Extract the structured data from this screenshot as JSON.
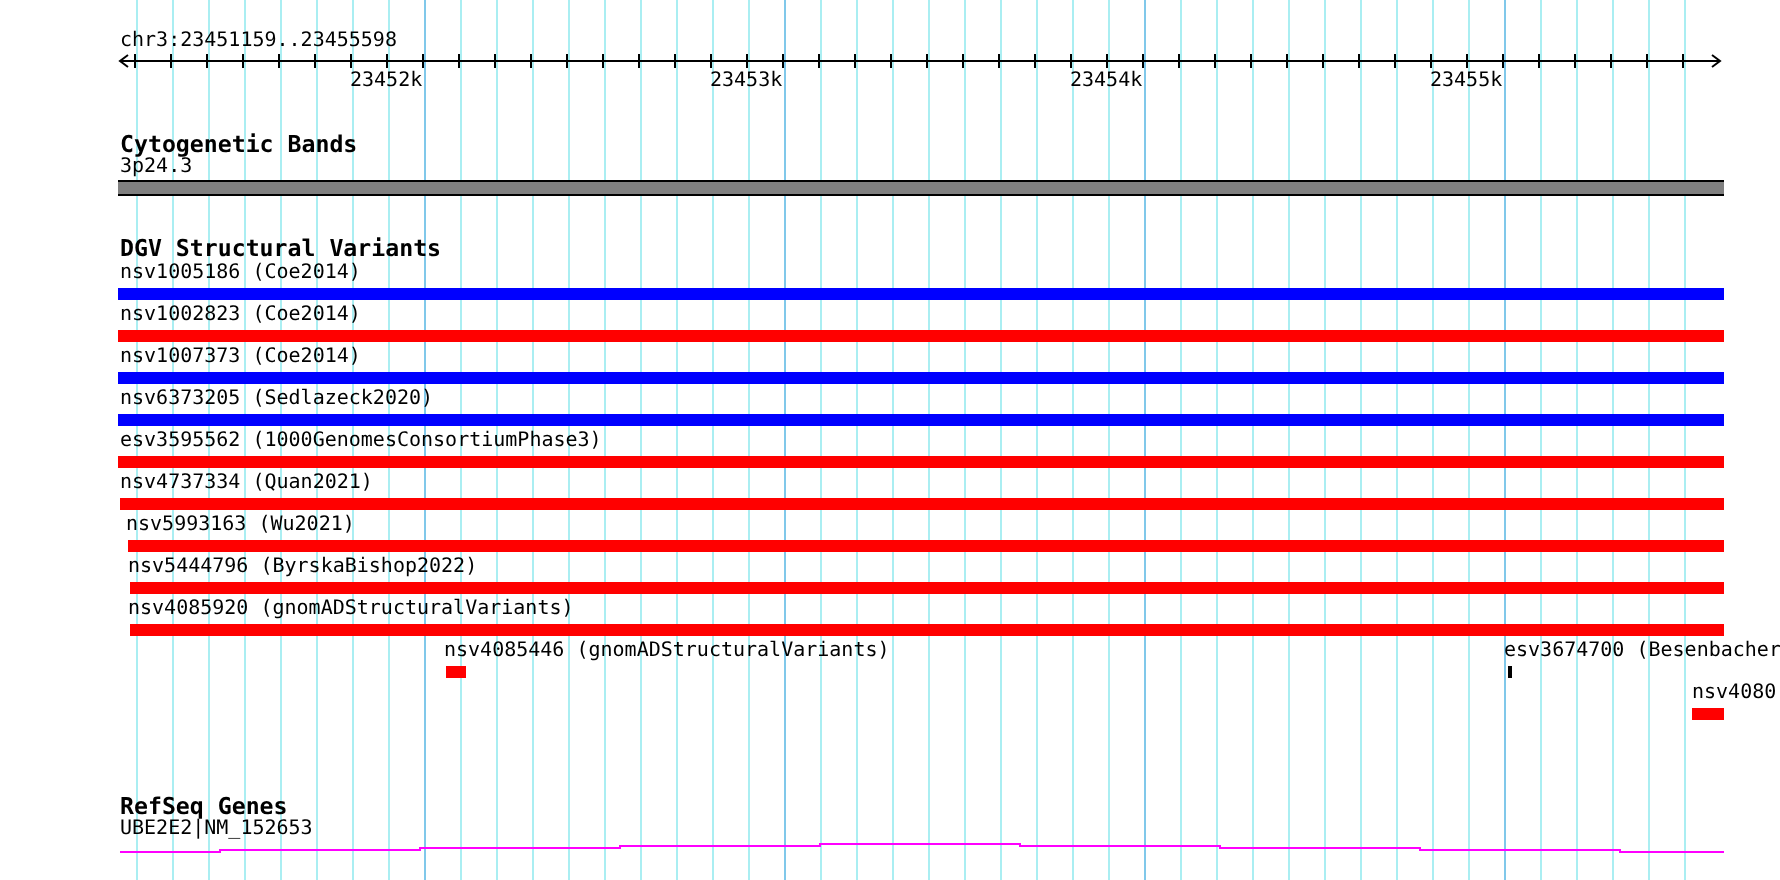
{
  "location": "chr3:23451159..23455598",
  "ruler": {
    "ticks": [
      "23452k",
      "23453k",
      "23454k",
      "23455k"
    ]
  },
  "tracks": [
    {
      "kind": "bands",
      "title": "Cytogenetic Bands",
      "features": [
        {
          "label": "3p24.3"
        }
      ]
    },
    {
      "kind": "variants",
      "title": "DGV Structural Variants",
      "features": [
        {
          "label": "nsv1005186 (Coe2014)",
          "color": "#0000ff"
        },
        {
          "label": "nsv1002823 (Coe2014)",
          "color": "#ff0000"
        },
        {
          "label": "nsv1007373 (Coe2014)",
          "color": "#0000ff"
        },
        {
          "label": "nsv6373205 (Sedlazeck2020)",
          "color": "#0000ff"
        },
        {
          "label": "esv3595562 (1000GenomesConsortiumPhase3)",
          "color": "#ff0000"
        },
        {
          "label": "nsv4737334 (Quan2021)",
          "color": "#ff0000"
        },
        {
          "label": "nsv5993163 (Wu2021)",
          "color": "#ff0000"
        },
        {
          "label": "nsv5444796 (ByrskaBishop2022)",
          "color": "#ff0000"
        },
        {
          "label": "nsv4085920 (gnomADStructuralVariants)",
          "color": "#ff0000"
        },
        {
          "label": "nsv4085446 (gnomADStructuralVariants)",
          "color": "#ff0000"
        },
        {
          "label": "esv3674700 (Besenbacher",
          "color": "#000000"
        },
        {
          "label": "nsv4080",
          "color": "#ff0000"
        }
      ]
    },
    {
      "kind": "genes",
      "title": "RefSeq Genes",
      "features": [
        {
          "label": "UBE2E2|NM_152653"
        }
      ]
    }
  ]
}
